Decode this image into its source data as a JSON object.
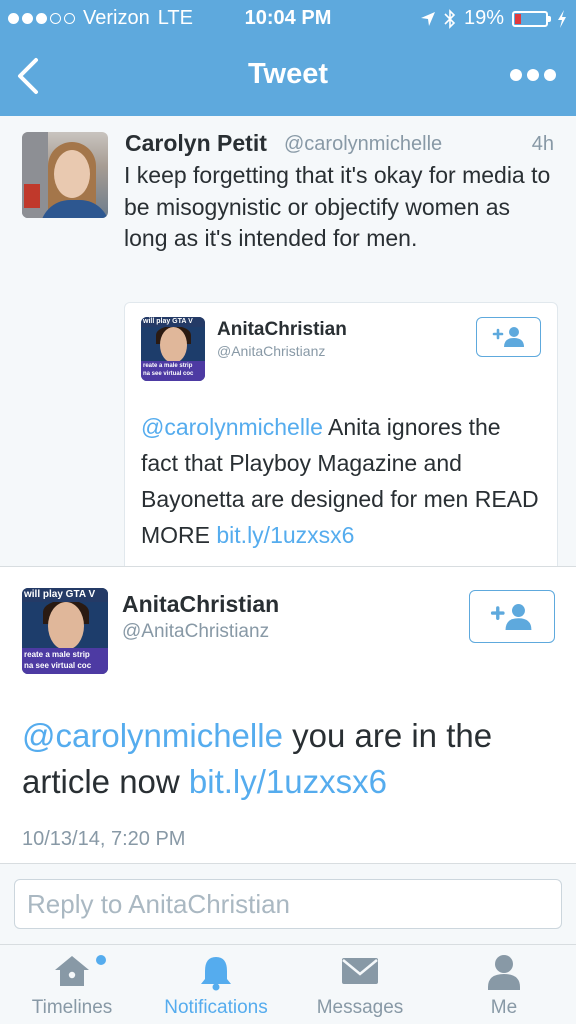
{
  "status_bar": {
    "carrier": "Verizon",
    "network": "LTE",
    "time": "10:04 PM",
    "battery": "19%",
    "battery_level": 0.19
  },
  "nav": {
    "title": "Tweet"
  },
  "tweet": {
    "author_name": "Carolyn Petit",
    "author_handle": "@carolynmichelle",
    "age": "4h",
    "text": "I keep forgetting that it's okay for media to be misogynistic or objectify women as long as it's intended for men.",
    "quoted": {
      "author_name": "AnitaChristian",
      "author_handle": "@AnitaChristianz",
      "mention": "@carolynmichelle",
      "text": " Anita ignores the fact that Playboy Magazine and Bayonetta are designed for men READ MORE ",
      "link": "bit.ly/1uzxsx6"
    }
  },
  "reply_tweet": {
    "author_name": "AnitaChristian",
    "author_handle": "@AnitaChristianz",
    "mention": "@carolynmichelle",
    "text": " you are in the article now ",
    "link": "bit.ly/1uzxsx6",
    "date": "10/13/14, 7:20 PM"
  },
  "avatar_text": {
    "top": "will play GTA V",
    "bottom_line1": "reate a male strip",
    "bottom_line2": "na see virtual coc"
  },
  "reply_box": {
    "placeholder": "Reply to AnitaChristian"
  },
  "tabs": [
    {
      "label": "Timelines",
      "icon": "home-icon",
      "active": false
    },
    {
      "label": "Notifications",
      "icon": "bell-icon",
      "active": true
    },
    {
      "label": "Messages",
      "icon": "envelope-icon",
      "active": false
    },
    {
      "label": "Me",
      "icon": "person-icon",
      "active": false
    }
  ],
  "colors": {
    "header": "#5ea9dd",
    "link": "#55acee",
    "text": "#292f33",
    "muted": "#8899a6",
    "battery_low": "#e0393e"
  }
}
